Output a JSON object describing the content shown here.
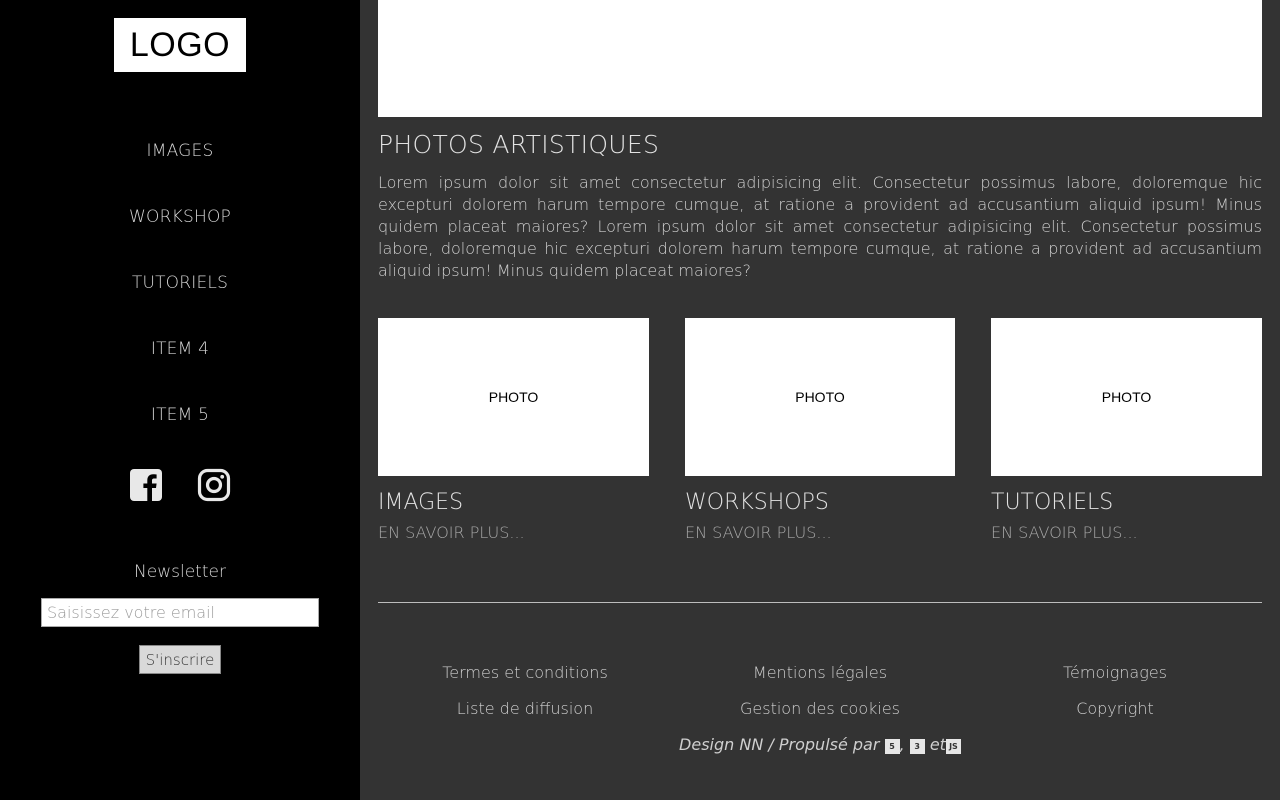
{
  "sidebar": {
    "logo": "LOGO",
    "nav": [
      "IMAGES",
      "WORKSHOP",
      "TUTORIELS",
      "ITEM 4",
      "ITEM 5"
    ],
    "social": [
      "facebook-icon",
      "instagram-icon"
    ],
    "newsletter": {
      "label": "Newsletter",
      "placeholder": "Saisissez votre email",
      "button": "S'inscrire"
    }
  },
  "main": {
    "title": "PHOTOS ARTISTIQUES",
    "text": "Lorem ipsum dolor sit amet consectetur adipisicing elit. Consectetur possimus labore, doloremque hic excepturi dolorem harum tempore cumque, at ratione a provident ad accusantium aliquid ipsum! Minus quidem placeat maiores? Lorem ipsum dolor sit amet consectetur adipisicing elit. Consectetur possimus labore, doloremque hic excepturi dolorem harum tempore cumque, at ratione a provident ad accusantium aliquid ipsum! Minus quidem placeat maiores?",
    "cards": [
      {
        "photo": "PHOTO",
        "title": "IMAGES",
        "link": "EN SAVOIR PLUS..."
      },
      {
        "photo": "PHOTO",
        "title": "WORKSHOPS",
        "link": "EN SAVOIR PLUS..."
      },
      {
        "photo": "PHOTO",
        "title": "TUTORIELS",
        "link": "EN SAVOIR PLUS..."
      }
    ]
  },
  "footer": {
    "links": [
      "Termes et conditions",
      "Mentions légales",
      "Témoignages",
      "Liste de diffusion",
      "Gestion des cookies",
      "Copyright"
    ],
    "credits_prefix": "Design NN / Propulsé par",
    "credits_sep": ",",
    "credits_and": "et",
    "tech": [
      "5",
      "3",
      "JS"
    ]
  }
}
